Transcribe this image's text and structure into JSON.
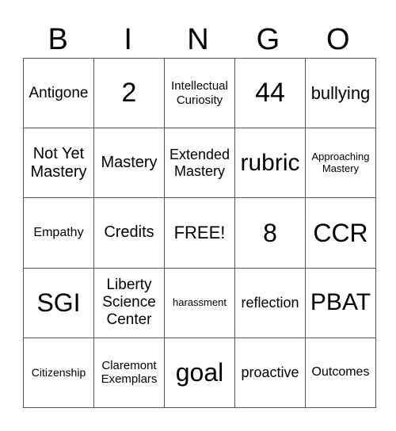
{
  "header": {
    "letters": [
      "B",
      "I",
      "N",
      "G",
      "O"
    ]
  },
  "grid": {
    "rows": [
      [
        "Antigone",
        "2",
        "Intellectual Curiosity",
        "44",
        "bullying"
      ],
      [
        "Not Yet Mastery",
        "Mastery",
        "Extended Mastery",
        "rubric",
        "Approaching Mastery"
      ],
      [
        "Empathy",
        "Credits",
        "FREE!",
        "8",
        "CCR"
      ],
      [
        "SGI",
        "Liberty Science Center",
        "harassment",
        "reflection",
        "PBAT"
      ],
      [
        "Citizenship",
        "Claremont Exemplars",
        "goal",
        "proactive",
        "Outcomes"
      ]
    ]
  }
}
